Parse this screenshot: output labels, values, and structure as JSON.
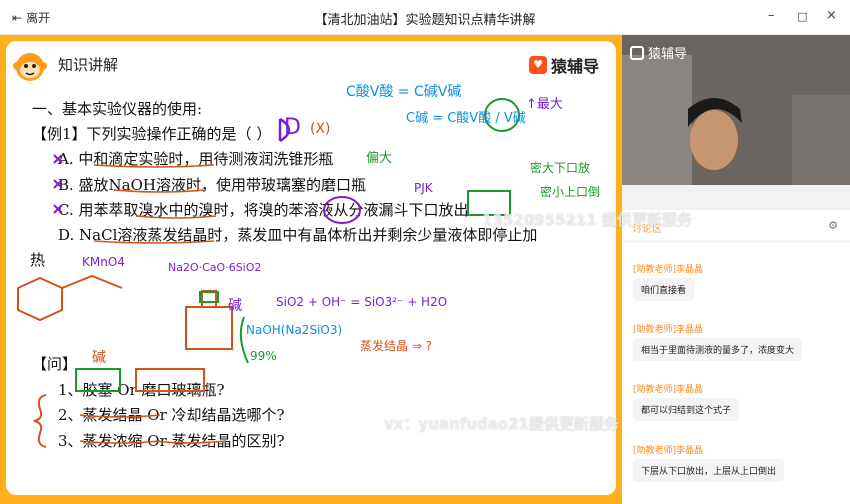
{
  "window": {
    "leave_label": "离开",
    "title": "【清北加油站】实验题知识点精华讲解",
    "min": "–",
    "max": "□",
    "close": "×"
  },
  "slide": {
    "title": "知识讲解",
    "brand": "猿辅导",
    "section": "一、基本实验仪器的使用:",
    "example": "【例1】下列实验操作正确的是（    ）",
    "options": [
      "A.  中和滴定实验时，用待测液润洗锥形瓶",
      "B.  盛放NaOH溶液时，使用带玻璃塞的磨口瓶",
      "C.  用苯萃取溴水中的溴时，将溴的苯溶液从分液漏斗下口放出",
      "D.  NaCl溶液蒸发结晶时，蒸发皿中有晶体析出并剩余少量液体即停止加"
    ],
    "option_d_cont": "热",
    "question_label": "【问】",
    "questions": [
      "1、胶塞 Or 磨口玻璃瓶?",
      "2、蒸发结晶 Or 冷却结晶选哪个?",
      "3、蒸发浓缩 Or 蒸发结晶的区别?"
    ],
    "handwriting": {
      "answer": "D",
      "cross": "(X)",
      "formula1": "C酸V酸 = C碱V碱",
      "formula2": "C碱 = C酸V酸 / V碱",
      "note_big": "偏大",
      "note_max": "↑最大",
      "note_pj": "PJK",
      "note_upper": "密大下口放",
      "note_lower": "密小上口倒",
      "kmno4": "KMnO4",
      "glass": "Na2O·CaO·6SiO2",
      "naoh_base": "碱",
      "reaction": "SiO2 + OH⁻ = SiO3²⁻ + H2O",
      "naoh_label": "NaOH(Na2SiO3)",
      "percent": "99%",
      "evap": "蒸发结晶 ⇒ ?",
      "q_base": "碱"
    }
  },
  "video": {
    "brand": "猿辅导"
  },
  "discussion": {
    "tab": "讨论区",
    "messages": [
      {
        "name": "[助教老师]李晶晶",
        "text": "咱们直接看"
      },
      {
        "name": "[助教老师]李晶晶",
        "text": "相当于里面待测液的量多了，浓度变大"
      },
      {
        "name": "[助教老师]李晶晶",
        "text": "都可以归结到这个式子"
      },
      {
        "name": "[助教老师]李晶晶",
        "text": "下层从下口放出，上层从上口倒出"
      }
    ]
  },
  "watermarks": [
    "13520955211  提供更新服务",
    "vx：yuanfudao21提供更新服务"
  ]
}
